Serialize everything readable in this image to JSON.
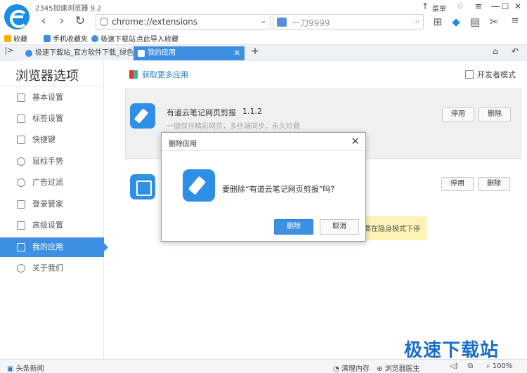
{
  "window": {
    "title": "2345加速浏览器 9.2",
    "menu_label": "菜单",
    "minimize": "—",
    "maximize": "☐",
    "close": "✕"
  },
  "toolbar": {
    "back": "‹",
    "forward": "›",
    "refresh": "↻",
    "home": "⌂",
    "address": "chrome://extensions",
    "address_dropdown": "⌄",
    "search_placeholder": "一刀9999",
    "search_icon": "⌕",
    "icons": [
      "apps-icon",
      "extension-icon",
      "reader-icon",
      "cut-icon",
      "more-icon"
    ]
  },
  "bookmarks": [
    {
      "label": "收藏",
      "color": "#f0b400"
    },
    {
      "label": "手机收藏夹",
      "color": "#3c8fe3"
    },
    {
      "label": "极速下载站",
      "color": "#3c8fe3"
    },
    {
      "label": "点此导入收藏",
      "color": "#ffffff"
    }
  ],
  "tabs": [
    {
      "label": "极速下载站_官方软件下载_绿色",
      "active": false
    },
    {
      "label": "我的应用",
      "active": true
    }
  ],
  "new_tab": "+",
  "sidebar": {
    "title": "浏览器选项",
    "items": [
      {
        "label": "基本设置",
        "icon": "gear-icon"
      },
      {
        "label": "标签设置",
        "icon": "tabs-icon"
      },
      {
        "label": "快捷键",
        "icon": "keyboard-icon"
      },
      {
        "label": "鼠标手势",
        "icon": "mouse-icon"
      },
      {
        "label": "广告过滤",
        "icon": "block-icon"
      },
      {
        "label": "登录管家",
        "icon": "lock-icon"
      },
      {
        "label": "高级设置",
        "icon": "wrench-icon"
      },
      {
        "label": "我的应用",
        "icon": "apps-icon",
        "active": true
      },
      {
        "label": "关于我们",
        "icon": "info-icon"
      }
    ]
  },
  "main": {
    "get_more": "获取更多应用",
    "dev_mode": "开发者模式",
    "extensions": [
      {
        "name": "有道云笔记网页剪报",
        "version": "1.1.2",
        "desc": "一键保存精彩网页，多终端同步，永久珍藏",
        "disable": "停用",
        "delete": "删除"
      },
      {
        "disable": "停用",
        "delete": "删除"
      }
    ],
    "incognito_note": "要在隐身模式下停"
  },
  "dialog": {
    "title": "删除应用",
    "close": "✕",
    "message": "要删除“有道云笔记网页剪报”吗？",
    "confirm": "删除",
    "cancel": "取消"
  },
  "statusbar": {
    "news": "头条新闻",
    "clean_memory": "清理内存",
    "doctor": "浏览器医生",
    "zoom": "100%"
  },
  "watermark": "极速下载站",
  "colors": {
    "accent": "#3c8fe3",
    "watermark": "#1b6fc9",
    "note": "#fdf3b4"
  }
}
